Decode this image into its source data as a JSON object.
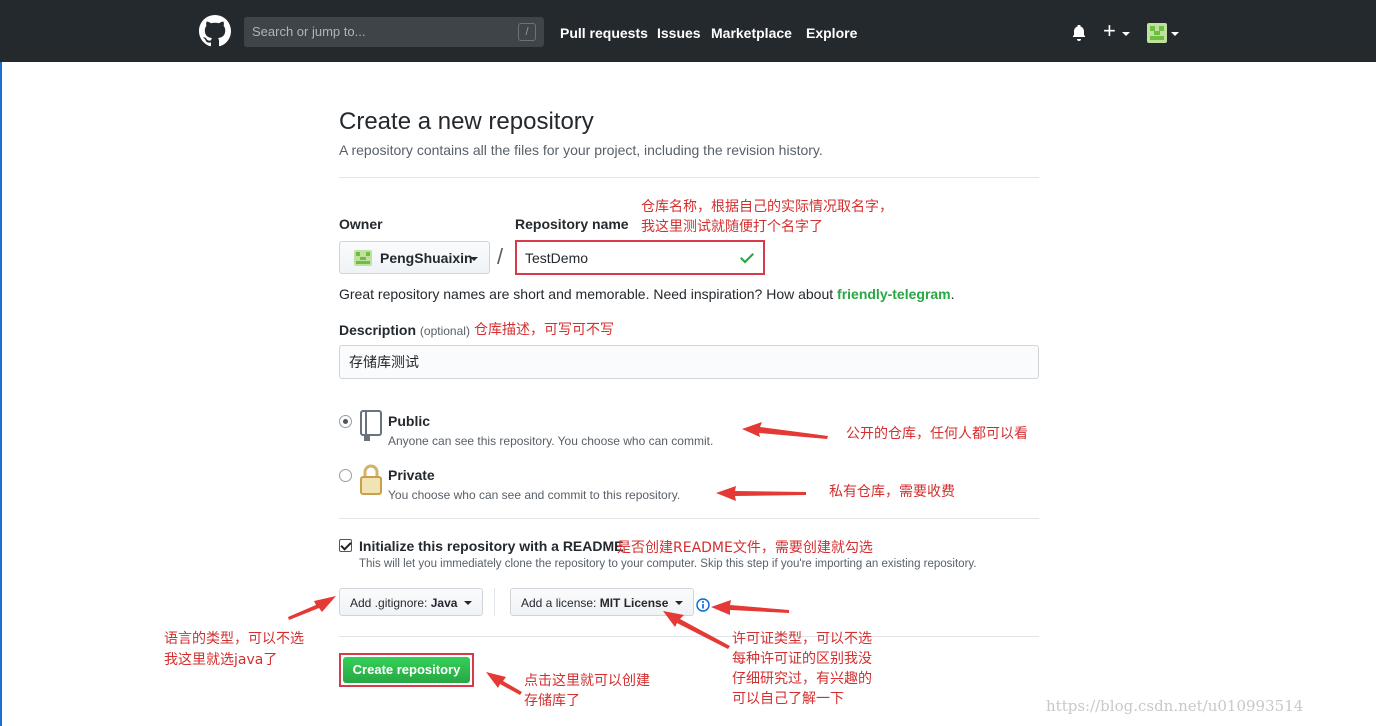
{
  "header": {
    "search_placeholder": "Search or jump to...",
    "search_shortcut": "/",
    "nav": [
      "Pull requests",
      "Issues",
      "Marketplace",
      "Explore"
    ],
    "plus_label": "+"
  },
  "page": {
    "title": "Create a new repository",
    "subtitle": "A repository contains all the files for your project, including the revision history."
  },
  "form": {
    "owner_label": "Owner",
    "owner_value": "PengShuaixin",
    "separator": "/",
    "repo_label": "Repository name",
    "repo_value": "TestDemo",
    "hint_text": "Great repository names are short and memorable. Need inspiration? How about ",
    "hint_suggestion": "friendly-telegram",
    "hint_end": ".",
    "description_label": "Description",
    "description_optional": "(optional)",
    "description_value": "存储库测试",
    "visibility": [
      {
        "title": "Public",
        "desc": "Anyone can see this repository. You choose who can commit.",
        "checked": true
      },
      {
        "title": "Private",
        "desc": "You choose who can see and commit to this repository.",
        "checked": false
      }
    ],
    "init_title": "Initialize this repository with a README",
    "init_desc": "This will let you immediately clone the repository to your computer. Skip this step if you're importing an existing repository.",
    "gitignore_prefix": "Add .gitignore: ",
    "gitignore_value": "Java",
    "license_prefix": "Add a license: ",
    "license_value": "MIT License",
    "create_button": "Create repository"
  },
  "annotations": {
    "repo_name_1": "仓库名称，根据自己的实际情况取名字，",
    "repo_name_2": "我这里测试就随便打个名字了",
    "description": "仓库描述，可写可不写",
    "public": "公开的仓库，任何人都可以看",
    "private": "私有仓库，需要收费",
    "readme": "是否创建README文件，需要创建就勾选",
    "language_1": "语言的类型，可以不选",
    "language_2": "我这里就选java了",
    "license_1": "许可证类型，可以不选",
    "license_2": "每种许可证的区别我没",
    "license_3": "仔细研究过，有兴趣的",
    "license_4": "可以自己了解一下",
    "create_1": "点击这里就可以创建",
    "create_2": "存储库了"
  },
  "watermark": "https://blog.csdn.net/u010993514",
  "colors": {
    "header_bg": "#24292e",
    "primary_green": "#28a745",
    "annotation_red": "#d32f2f"
  }
}
